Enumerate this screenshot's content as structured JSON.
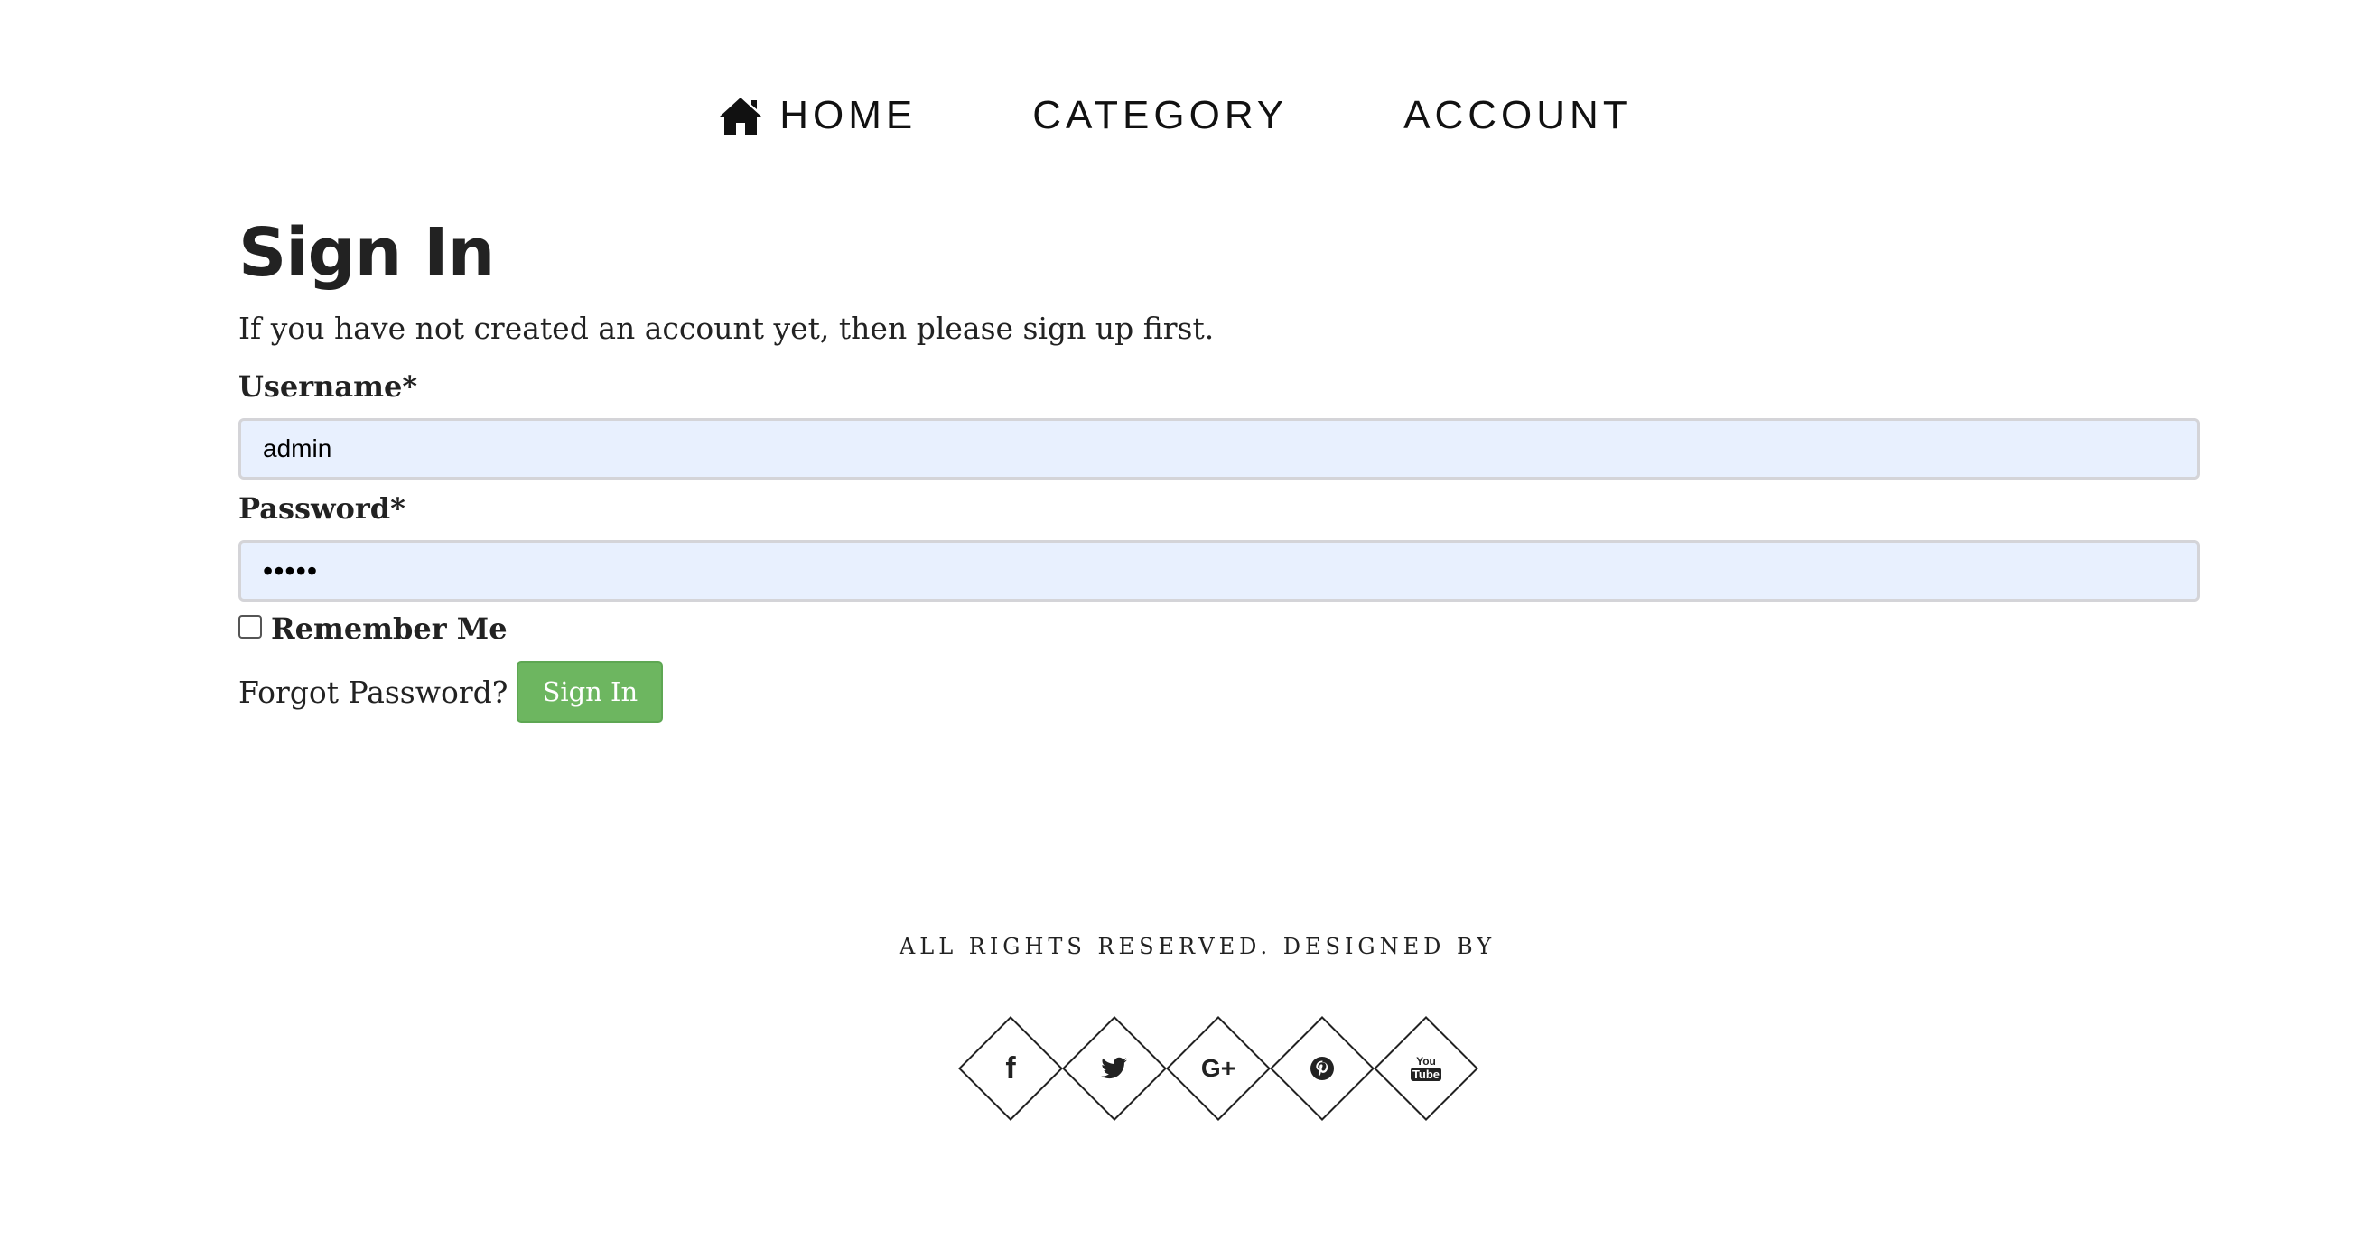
{
  "nav": {
    "items": [
      {
        "label": "HOME",
        "icon": "home-icon"
      },
      {
        "label": "CATEGORY"
      },
      {
        "label": "ACCOUNT"
      }
    ]
  },
  "main": {
    "title": "Sign In",
    "intro": "If you have not created an account yet, then please sign up first.",
    "username": {
      "label": "Username*",
      "value": "admin"
    },
    "password": {
      "label": "Password*",
      "value": "•••••"
    },
    "remember_label": "Remember Me",
    "forgot_label": "Forgot Password?",
    "signin_label": "Sign In"
  },
  "footer": {
    "text": "ALL RIGHTS RESERVED. DESIGNED BY",
    "socials": [
      {
        "icon": "facebook-icon",
        "glyph": "f"
      },
      {
        "icon": "twitter-icon"
      },
      {
        "icon": "google-plus-icon",
        "glyph": "G+"
      },
      {
        "icon": "pinterest-icon"
      },
      {
        "icon": "youtube-icon",
        "glyph_top": "You",
        "glyph_bottom": "Tube"
      }
    ]
  },
  "colors": {
    "button_bg": "#6db660",
    "input_bg": "#e8f0fe",
    "text": "#222222"
  }
}
